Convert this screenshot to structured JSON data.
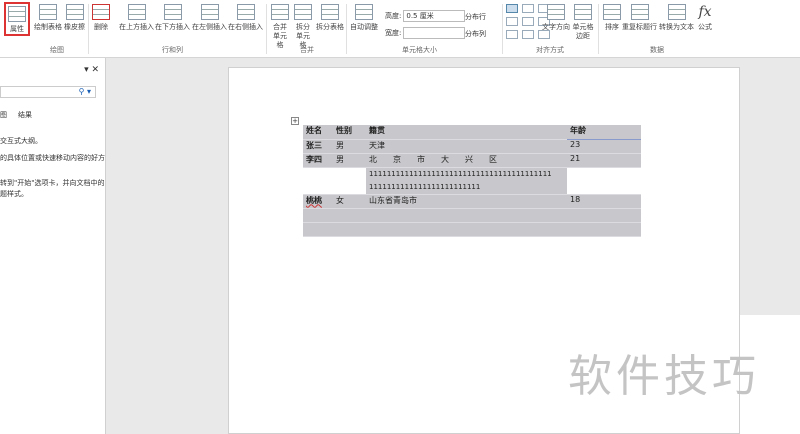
{
  "ribbon": {
    "properties": "属性",
    "draw_table": "绘制表格",
    "eraser": "橡皮擦",
    "group_draw": "绘图",
    "delete": "删除",
    "insert_above": "在上方插入",
    "insert_below": "在下方插入",
    "insert_left": "在左侧插入",
    "insert_right": "在右侧插入",
    "group_rows_cols": "行和列",
    "merge_cells": "合并单元格",
    "split_cells": "拆分单元格",
    "split_table": "拆分表格",
    "group_merge": "合并",
    "autofit": "自动调整",
    "height_label": "高度:",
    "height_value": "0.5 厘米",
    "width_label": "宽度:",
    "width_value": "",
    "distribute_rows": "分布行",
    "distribute_cols": "分布列",
    "group_cell_size": "单元格大小",
    "text_direction": "文字方向",
    "cell_margins": "单元格边距",
    "group_alignment": "对齐方式",
    "sort": "排序",
    "repeat_header": "重复标题行",
    "convert_text": "转换为文本",
    "formula": "公式",
    "group_data": "数据"
  },
  "pane": {
    "tab_results": "结果",
    "tab_partial": "图",
    "line1": "交互式大纲。",
    "line2": "的具体位置或快速移动内容的好方",
    "line3": "转到\"开始\"选项卡，并向文档中的",
    "line4": "题样式。"
  },
  "table": {
    "headers": [
      "姓名",
      "性别",
      "籍贯",
      "年龄"
    ],
    "rows": [
      [
        "张三",
        "男",
        "天津",
        "23"
      ],
      [
        "李四",
        "男",
        "北　　京　　市　　大　　兴　　区",
        "21"
      ],
      [
        "",
        "",
        "11111111111111111111111111111111111111111",
        "1111111111111111111111111"
      ],
      [
        "桃桃",
        "女",
        "山东省青岛市",
        "18"
      ]
    ]
  },
  "watermark": "软件技巧"
}
